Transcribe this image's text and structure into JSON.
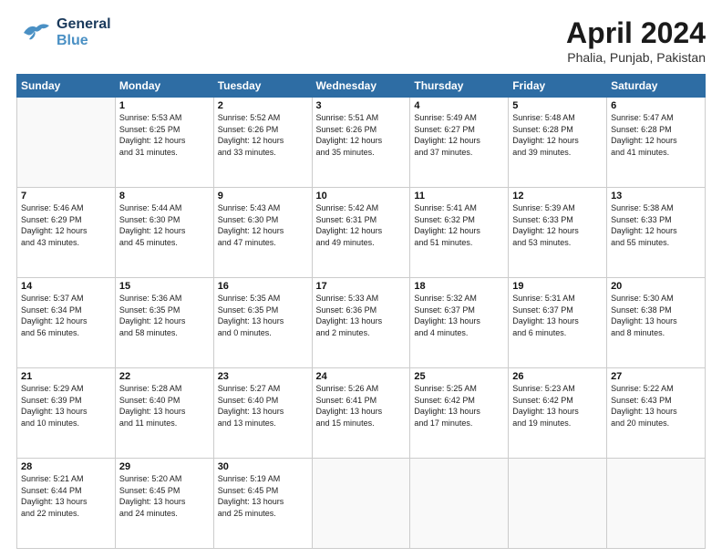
{
  "header": {
    "logo_general": "General",
    "logo_blue": "Blue",
    "month_title": "April 2024",
    "location": "Phalia, Punjab, Pakistan"
  },
  "calendar": {
    "headers": [
      "Sunday",
      "Monday",
      "Tuesday",
      "Wednesday",
      "Thursday",
      "Friday",
      "Saturday"
    ],
    "weeks": [
      [
        {
          "day": "",
          "content": ""
        },
        {
          "day": "1",
          "content": "Sunrise: 5:53 AM\nSunset: 6:25 PM\nDaylight: 12 hours\nand 31 minutes."
        },
        {
          "day": "2",
          "content": "Sunrise: 5:52 AM\nSunset: 6:26 PM\nDaylight: 12 hours\nand 33 minutes."
        },
        {
          "day": "3",
          "content": "Sunrise: 5:51 AM\nSunset: 6:26 PM\nDaylight: 12 hours\nand 35 minutes."
        },
        {
          "day": "4",
          "content": "Sunrise: 5:49 AM\nSunset: 6:27 PM\nDaylight: 12 hours\nand 37 minutes."
        },
        {
          "day": "5",
          "content": "Sunrise: 5:48 AM\nSunset: 6:28 PM\nDaylight: 12 hours\nand 39 minutes."
        },
        {
          "day": "6",
          "content": "Sunrise: 5:47 AM\nSunset: 6:28 PM\nDaylight: 12 hours\nand 41 minutes."
        }
      ],
      [
        {
          "day": "7",
          "content": "Sunrise: 5:46 AM\nSunset: 6:29 PM\nDaylight: 12 hours\nand 43 minutes."
        },
        {
          "day": "8",
          "content": "Sunrise: 5:44 AM\nSunset: 6:30 PM\nDaylight: 12 hours\nand 45 minutes."
        },
        {
          "day": "9",
          "content": "Sunrise: 5:43 AM\nSunset: 6:30 PM\nDaylight: 12 hours\nand 47 minutes."
        },
        {
          "day": "10",
          "content": "Sunrise: 5:42 AM\nSunset: 6:31 PM\nDaylight: 12 hours\nand 49 minutes."
        },
        {
          "day": "11",
          "content": "Sunrise: 5:41 AM\nSunset: 6:32 PM\nDaylight: 12 hours\nand 51 minutes."
        },
        {
          "day": "12",
          "content": "Sunrise: 5:39 AM\nSunset: 6:33 PM\nDaylight: 12 hours\nand 53 minutes."
        },
        {
          "day": "13",
          "content": "Sunrise: 5:38 AM\nSunset: 6:33 PM\nDaylight: 12 hours\nand 55 minutes."
        }
      ],
      [
        {
          "day": "14",
          "content": "Sunrise: 5:37 AM\nSunset: 6:34 PM\nDaylight: 12 hours\nand 56 minutes."
        },
        {
          "day": "15",
          "content": "Sunrise: 5:36 AM\nSunset: 6:35 PM\nDaylight: 12 hours\nand 58 minutes."
        },
        {
          "day": "16",
          "content": "Sunrise: 5:35 AM\nSunset: 6:35 PM\nDaylight: 13 hours\nand 0 minutes."
        },
        {
          "day": "17",
          "content": "Sunrise: 5:33 AM\nSunset: 6:36 PM\nDaylight: 13 hours\nand 2 minutes."
        },
        {
          "day": "18",
          "content": "Sunrise: 5:32 AM\nSunset: 6:37 PM\nDaylight: 13 hours\nand 4 minutes."
        },
        {
          "day": "19",
          "content": "Sunrise: 5:31 AM\nSunset: 6:37 PM\nDaylight: 13 hours\nand 6 minutes."
        },
        {
          "day": "20",
          "content": "Sunrise: 5:30 AM\nSunset: 6:38 PM\nDaylight: 13 hours\nand 8 minutes."
        }
      ],
      [
        {
          "day": "21",
          "content": "Sunrise: 5:29 AM\nSunset: 6:39 PM\nDaylight: 13 hours\nand 10 minutes."
        },
        {
          "day": "22",
          "content": "Sunrise: 5:28 AM\nSunset: 6:40 PM\nDaylight: 13 hours\nand 11 minutes."
        },
        {
          "day": "23",
          "content": "Sunrise: 5:27 AM\nSunset: 6:40 PM\nDaylight: 13 hours\nand 13 minutes."
        },
        {
          "day": "24",
          "content": "Sunrise: 5:26 AM\nSunset: 6:41 PM\nDaylight: 13 hours\nand 15 minutes."
        },
        {
          "day": "25",
          "content": "Sunrise: 5:25 AM\nSunset: 6:42 PM\nDaylight: 13 hours\nand 17 minutes."
        },
        {
          "day": "26",
          "content": "Sunrise: 5:23 AM\nSunset: 6:42 PM\nDaylight: 13 hours\nand 19 minutes."
        },
        {
          "day": "27",
          "content": "Sunrise: 5:22 AM\nSunset: 6:43 PM\nDaylight: 13 hours\nand 20 minutes."
        }
      ],
      [
        {
          "day": "28",
          "content": "Sunrise: 5:21 AM\nSunset: 6:44 PM\nDaylight: 13 hours\nand 22 minutes."
        },
        {
          "day": "29",
          "content": "Sunrise: 5:20 AM\nSunset: 6:45 PM\nDaylight: 13 hours\nand 24 minutes."
        },
        {
          "day": "30",
          "content": "Sunrise: 5:19 AM\nSunset: 6:45 PM\nDaylight: 13 hours\nand 25 minutes."
        },
        {
          "day": "",
          "content": ""
        },
        {
          "day": "",
          "content": ""
        },
        {
          "day": "",
          "content": ""
        },
        {
          "day": "",
          "content": ""
        }
      ]
    ]
  }
}
